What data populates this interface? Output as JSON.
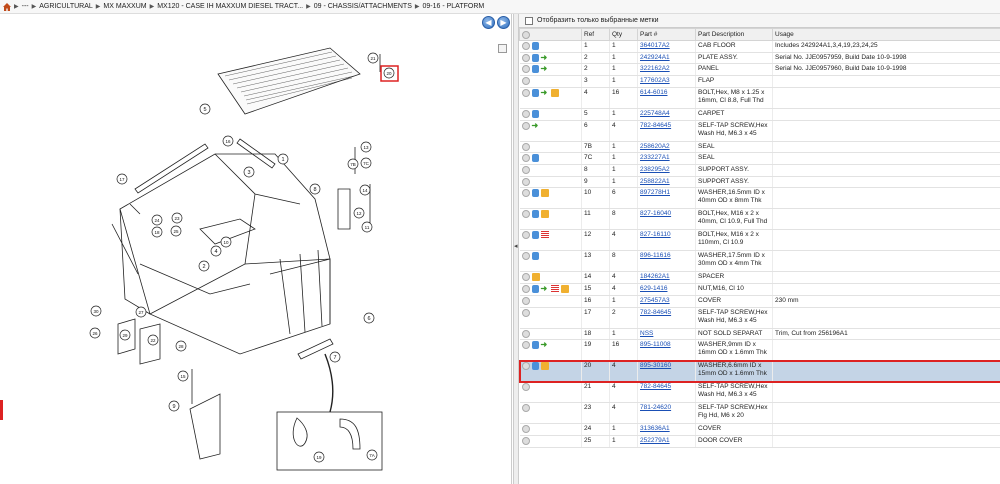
{
  "breadcrumb": {
    "items": [
      "---",
      "AGRICULTURAL",
      "MX MAXXUM",
      "MX120 - CASE IH MAXXUM DIESEL TRACT...",
      "09 - CHASSIS/ATTACHMENTS",
      "09-16 - PLATFORM"
    ]
  },
  "filter": {
    "label": "Отобразить только выбранные метки"
  },
  "table": {
    "headers": [
      "",
      "Ref",
      "Qty",
      "Part #",
      "Part Description",
      "Usage"
    ],
    "rows": [
      {
        "icons": [
          "g",
          "b"
        ],
        "ref": "1",
        "qty": "1",
        "part": "364017A2",
        "desc": "CAB FLOOR",
        "usage": "Includes 242924A1,3,4,19,23,24,25",
        "h": 11
      },
      {
        "icons": [
          "g",
          "b",
          "ar"
        ],
        "ref": "2",
        "qty": "1",
        "part": "242924A1",
        "desc": "PLATE ASSY.",
        "usage": "Serial No. JJE0957959, Build Date 10-9-1998",
        "h": 11
      },
      {
        "icons": [
          "g",
          "b",
          "ar"
        ],
        "ref": "2",
        "qty": "1",
        "part": "322162A2",
        "desc": "PANEL",
        "usage": "Serial No. JJE0957960, Build Date 10-9-1998",
        "h": 11
      },
      {
        "icons": [
          "g"
        ],
        "ref": "3",
        "qty": "1",
        "part": "177602A3",
        "desc": "FLAP",
        "usage": "",
        "h": 11
      },
      {
        "icons": [
          "g",
          "b",
          "ar",
          "pk"
        ],
        "ref": "4",
        "qty": "16",
        "part": "614-6016",
        "desc": "BOLT,Hex, M8 x 1.25 x 16mm, Cl 8.8, Full Thd",
        "usage": "",
        "h": 20
      },
      {
        "icons": [
          "g",
          "b"
        ],
        "ref": "5",
        "qty": "1",
        "part": "225748A4",
        "desc": "CARPET",
        "usage": "",
        "h": 11
      },
      {
        "icons": [
          "g",
          "ar"
        ],
        "ref": "6",
        "qty": "4",
        "part": "782-84645",
        "desc": "SELF-TAP SCREW,Hex Wash Hd, M6.3 x 45",
        "usage": "",
        "h": 20
      },
      {
        "icons": [
          "g"
        ],
        "ref": "7B",
        "qty": "1",
        "part": "258620A2",
        "desc": "SEAL",
        "usage": "",
        "h": 11
      },
      {
        "icons": [
          "g",
          "b"
        ],
        "ref": "7C",
        "qty": "1",
        "part": "233227A1",
        "desc": "SEAL",
        "usage": "",
        "h": 11
      },
      {
        "icons": [
          "g"
        ],
        "ref": "8",
        "qty": "1",
        "part": "238295A2",
        "desc": "SUPPORT ASSY.",
        "usage": "",
        "h": 11
      },
      {
        "icons": [
          "g"
        ],
        "ref": "9",
        "qty": "1",
        "part": "258822A1",
        "desc": "SUPPORT ASSY.",
        "usage": "",
        "h": 11
      },
      {
        "icons": [
          "g",
          "b",
          "pk"
        ],
        "ref": "10",
        "qty": "6",
        "part": "897278H1",
        "desc": "WASHER,16.5mm ID x 40mm OD x 8mm Thk",
        "usage": "",
        "h": 20
      },
      {
        "icons": [
          "g",
          "b",
          "pk"
        ],
        "ref": "11",
        "qty": "8",
        "part": "827-16040",
        "desc": "BOLT,Hex, M16 x 2 x 40mm, Cl 10.9, Full Thd",
        "usage": "",
        "h": 20
      },
      {
        "icons": [
          "g",
          "b",
          "rd"
        ],
        "ref": "12",
        "qty": "4",
        "part": "827-16110",
        "desc": "BOLT,Hex, M16 x 2 x 110mm, Cl 10.9",
        "usage": "",
        "h": 20
      },
      {
        "icons": [
          "g",
          "b"
        ],
        "ref": "13",
        "qty": "8",
        "part": "896-11616",
        "desc": "WASHER,17.5mm ID x 30mm OD x 4mm Thk",
        "usage": "",
        "h": 20
      },
      {
        "icons": [
          "g",
          "pk"
        ],
        "ref": "14",
        "qty": "4",
        "part": "184262A1",
        "desc": "SPACER",
        "usage": "",
        "h": 11
      },
      {
        "icons": [
          "g",
          "b",
          "ar",
          "rd",
          "pk"
        ],
        "ref": "15",
        "qty": "4",
        "part": "629-1416",
        "desc": "NUT,M16, Cl 10",
        "usage": "",
        "h": 11
      },
      {
        "icons": [
          "g"
        ],
        "ref": "16",
        "qty": "1",
        "part": "275457A3",
        "desc": "COVER",
        "usage": "230 mm",
        "h": 11
      },
      {
        "icons": [
          "g"
        ],
        "ref": "17",
        "qty": "2",
        "part": "782-84645",
        "desc": "SELF-TAP SCREW,Hex Wash Hd, M6.3 x 45",
        "usage": "",
        "h": 20
      },
      {
        "icons": [
          "g"
        ],
        "ref": "18",
        "qty": "1",
        "part": "NSS",
        "desc": "NOT SOLD SEPARAT",
        "usage": "Trim, Cut from 256196A1",
        "h": 11
      },
      {
        "icons": [
          "g",
          "b",
          "ar"
        ],
        "ref": "19",
        "qty": "16",
        "part": "895-11008",
        "desc": "WASHER,9mm ID x 16mm OD x 1.6mm Thk",
        "usage": "",
        "h": 20
      },
      {
        "icons": [
          "g",
          "b",
          "pk"
        ],
        "ref": "20",
        "qty": "4",
        "part": "895-30160",
        "desc": "WASHER,6.6mm ID x 15mm OD x 1.6mm Thk",
        "usage": "",
        "h": 20,
        "sel": true
      },
      {
        "icons": [
          "g"
        ],
        "ref": "21",
        "qty": "4",
        "part": "782-84645",
        "desc": "SELF-TAP SCREW,Hex Wash Hd, M6.3 x 45",
        "usage": "",
        "h": 20
      },
      {
        "icons": [
          "g"
        ],
        "ref": "23",
        "qty": "4",
        "part": "781-24620",
        "desc": "SELF-TAP SCREW,Hex Flg Hd, M6 x 20",
        "usage": "",
        "h": 20
      },
      {
        "icons": [
          "g"
        ],
        "ref": "24",
        "qty": "1",
        "part": "313636A1",
        "desc": "COVER",
        "usage": "",
        "h": 11
      },
      {
        "icons": [
          "g"
        ],
        "ref": "25",
        "qty": "1",
        "part": "252279A1",
        "desc": "DOOR COVER",
        "usage": "",
        "h": 11
      }
    ]
  },
  "diagram": {
    "callouts": [
      "1",
      "2",
      "3",
      "4",
      "5",
      "6",
      "7",
      "7A",
      "7B",
      "7C",
      "8",
      "9",
      "10",
      "11",
      "12",
      "13",
      "14",
      "15",
      "16",
      "17",
      "18",
      "19",
      "20",
      "21",
      "22",
      "23",
      "24",
      "25",
      "26",
      "27",
      "28",
      "29",
      "30"
    ]
  }
}
